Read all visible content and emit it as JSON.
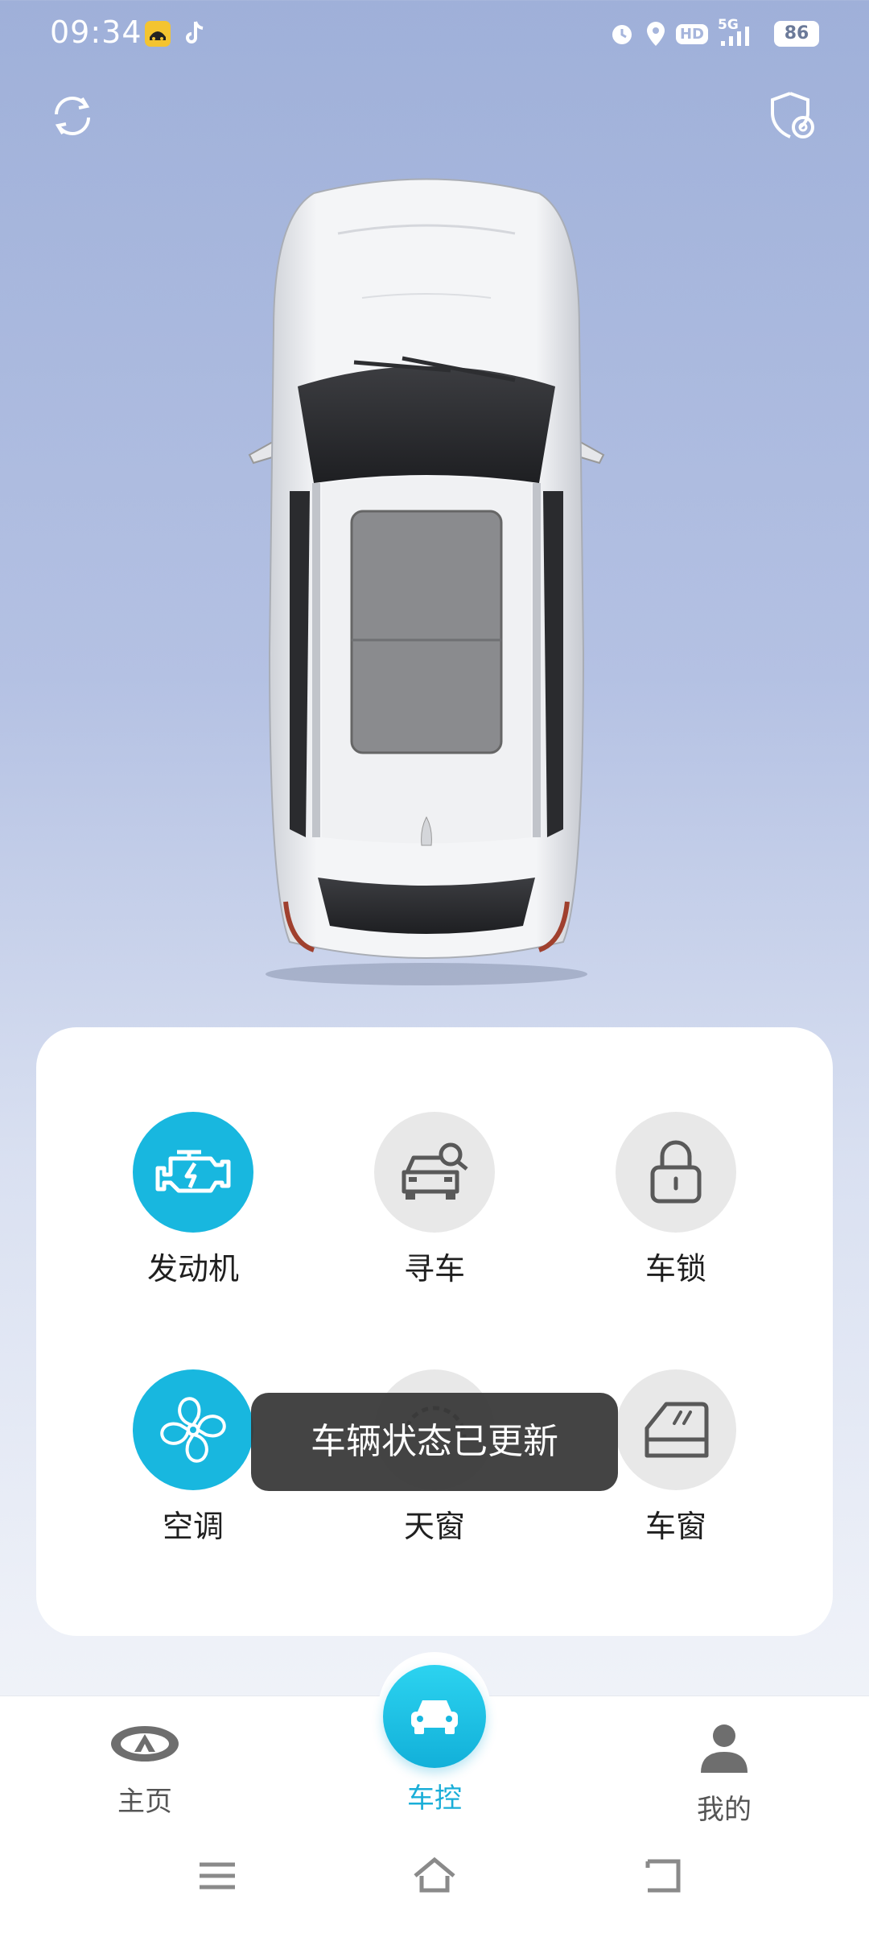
{
  "status": {
    "time": "09:34",
    "battery": "86",
    "network": "5G",
    "hd": "HD"
  },
  "controls": [
    {
      "label": "发动机",
      "icon": "engine-icon",
      "active": true
    },
    {
      "label": "寻车",
      "icon": "find-car-icon",
      "active": false
    },
    {
      "label": "车锁",
      "icon": "lock-icon",
      "active": false
    },
    {
      "label": "空调",
      "icon": "fan-icon",
      "active": true
    },
    {
      "label": "天窗",
      "icon": "sunroof-icon",
      "active": false
    },
    {
      "label": "车窗",
      "icon": "window-icon",
      "active": false
    }
  ],
  "toast": "车辆状态已更新",
  "nav": [
    {
      "label": "主页",
      "icon": "brand-logo-icon",
      "active": false
    },
    {
      "label": "车控",
      "icon": "car-icon",
      "active": true
    },
    {
      "label": "我的",
      "icon": "person-icon",
      "active": false
    }
  ],
  "colors": {
    "accent": "#18b7df",
    "toast_bg": "#383838",
    "card_bg": "#ffffff"
  }
}
